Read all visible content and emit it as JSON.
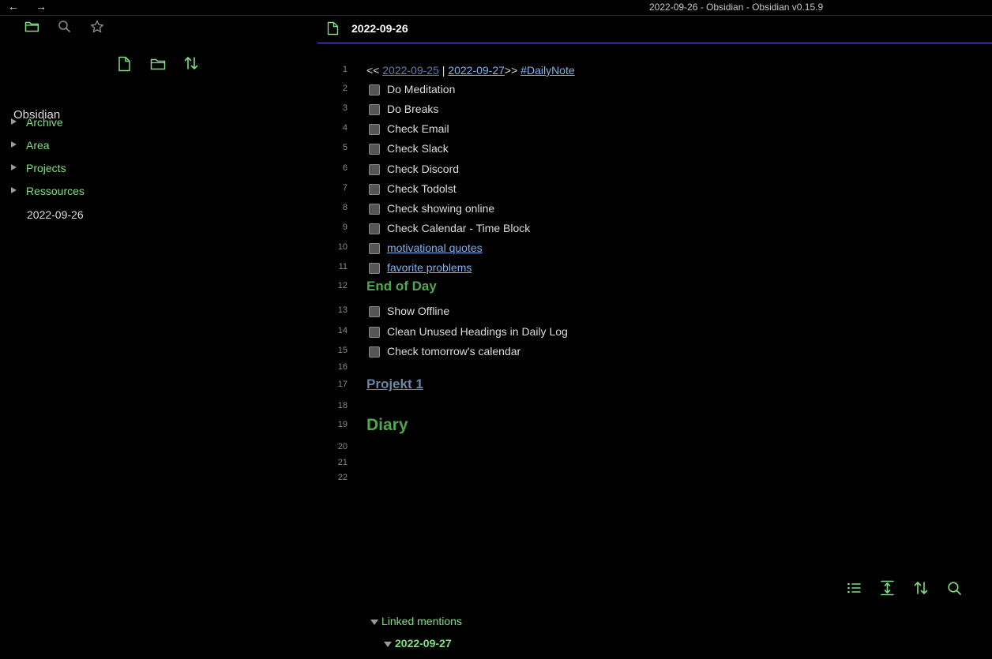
{
  "window": {
    "title": "2022-09-26 - Obsidian - Obsidian v0.15.9",
    "back_glyph": "←",
    "forward_glyph": "→"
  },
  "sidebar": {
    "top_icons": [
      "folder-icon",
      "search-icon",
      "star-icon"
    ],
    "actions": [
      "new-note-icon",
      "new-folder-icon",
      "sort-icon"
    ],
    "vault_name": "Obsidian",
    "folders": [
      {
        "label": "Archive"
      },
      {
        "label": "Area"
      },
      {
        "label": "Projects"
      },
      {
        "label": "Ressources"
      }
    ],
    "files": [
      {
        "label": "2022-09-26"
      }
    ]
  },
  "editor": {
    "tab_title": "2022-09-26",
    "line_numbers": [
      "1",
      "2",
      "3",
      "4",
      "5",
      "6",
      "7",
      "8",
      "9",
      "10",
      "11",
      "12",
      "13",
      "14",
      "15",
      "16",
      "17",
      "18",
      "19",
      "20",
      "21",
      "22"
    ],
    "nav_line": {
      "prefix": "<<",
      "prev": "2022-09-25",
      "sep": "|",
      "next": "2022-09-27",
      "suffix": ">>",
      "tag": "#DailyNote"
    },
    "tasks_morning": [
      {
        "text": "Do Meditation"
      },
      {
        "text": "Do Breaks"
      },
      {
        "text": "Check Email"
      },
      {
        "text": "Check Slack"
      },
      {
        "text": "Check Discord"
      },
      {
        "text": "Check Todolst"
      },
      {
        "text": "Check showing online"
      },
      {
        "text": "Check Calendar - Time Block"
      }
    ],
    "task_links": [
      {
        "text": "motivational quotes"
      },
      {
        "text": "favorite problems"
      }
    ],
    "heading_end_of_day": "End of Day",
    "tasks_evening": [
      {
        "text": "Show Offline"
      },
      {
        "text": "Clean Unused Headings in Daily Log"
      },
      {
        "text": "Check tomorrow's calendar"
      }
    ],
    "heading_project": "Projekt 1",
    "heading_diary": "Diary",
    "backlinks": {
      "icons": [
        "list-icon",
        "expand-icon",
        "sort-icon",
        "search-icon"
      ],
      "linked_mentions": "Linked mentions",
      "mention_file": "2022-09-27"
    }
  },
  "colors": {
    "accent_green": "#7ee07e",
    "heading_green": "#4fa84f",
    "link_blue": "#7fb2f0",
    "tab_underline": "#6c5fd0"
  }
}
